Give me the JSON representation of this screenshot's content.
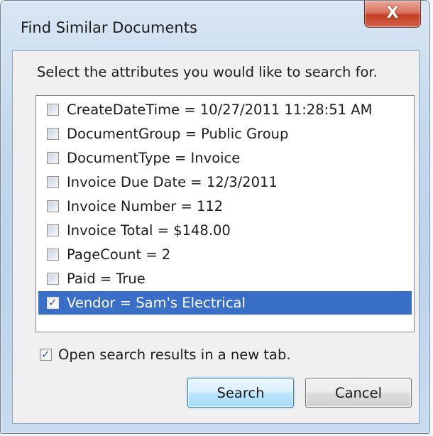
{
  "window": {
    "title": "Find Similar Documents",
    "close_label": "X"
  },
  "prompt": "Select the attributes you would like to search for.",
  "attributes": [
    {
      "label": "CreateDateTime = 10/27/2011 11:28:51 AM",
      "checked": false,
      "selected": false
    },
    {
      "label": "DocumentGroup = Public Group",
      "checked": false,
      "selected": false
    },
    {
      "label": "DocumentType = Invoice",
      "checked": false,
      "selected": false
    },
    {
      "label": "Invoice Due Date = 12/3/2011",
      "checked": false,
      "selected": false
    },
    {
      "label": "Invoice Number = 112",
      "checked": false,
      "selected": false
    },
    {
      "label": "Invoice Total = $148.00",
      "checked": false,
      "selected": false
    },
    {
      "label": "PageCount = 2",
      "checked": false,
      "selected": false
    },
    {
      "label": "Paid = True",
      "checked": false,
      "selected": false
    },
    {
      "label": "Vendor = Sam's Electrical",
      "checked": true,
      "selected": true
    }
  ],
  "new_tab": {
    "label": "Open search results in a new tab.",
    "checked": true
  },
  "buttons": {
    "search": "Search",
    "cancel": "Cancel"
  },
  "colors": {
    "selection": "#3a6fc7",
    "close_button": "#c23d22",
    "frame": "#bcd3ea"
  }
}
